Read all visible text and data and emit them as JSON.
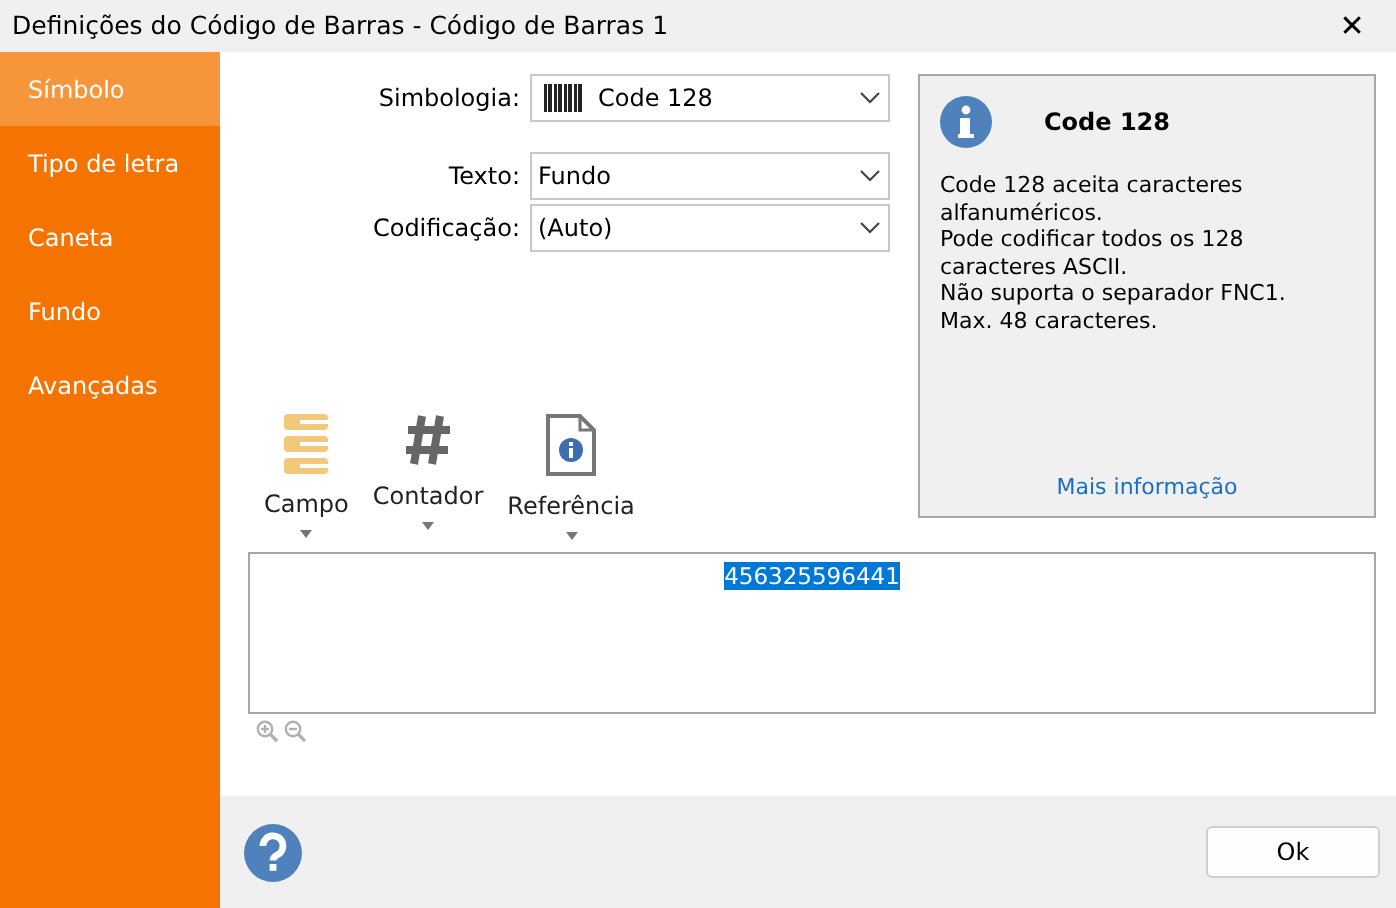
{
  "window": {
    "title": "Definições do Código de Barras - Código de Barras 1",
    "close": "✕"
  },
  "sidebar": {
    "items": [
      {
        "label": "Símbolo",
        "selected": true
      },
      {
        "label": "Tipo de letra",
        "selected": false
      },
      {
        "label": "Caneta",
        "selected": false
      },
      {
        "label": "Fundo",
        "selected": false
      },
      {
        "label": "Avançadas",
        "selected": false
      }
    ]
  },
  "form": [
    {
      "label": "Simbologia:",
      "value": "Code 128",
      "kind": "barcode"
    },
    {
      "label": "Texto:",
      "value": "Fundo",
      "kind": "plain"
    },
    {
      "label": "Codificação:",
      "value": "(Auto)",
      "kind": "plain"
    }
  ],
  "info": {
    "title": "Code 128",
    "text": "Code 128 aceita caracteres alfanuméricos.\nPode codificar todos os 128 caracteres ASCII.\nNão suporta o separador FNC1.\nMax. 48 caracteres.",
    "link": "Mais informação"
  },
  "toolbar": [
    {
      "label": "Campo",
      "kind": "field"
    },
    {
      "label": "Contador",
      "kind": "counter"
    },
    {
      "label": "Referência",
      "kind": "reference"
    }
  ],
  "editor": {
    "text": "456325596441",
    "highlighted": true
  },
  "zoom": [
    {
      "kind": "in",
      "disabled": true
    },
    {
      "kind": "out",
      "disabled": true
    }
  ],
  "buttons": [
    {
      "label": "Ok"
    }
  ]
}
